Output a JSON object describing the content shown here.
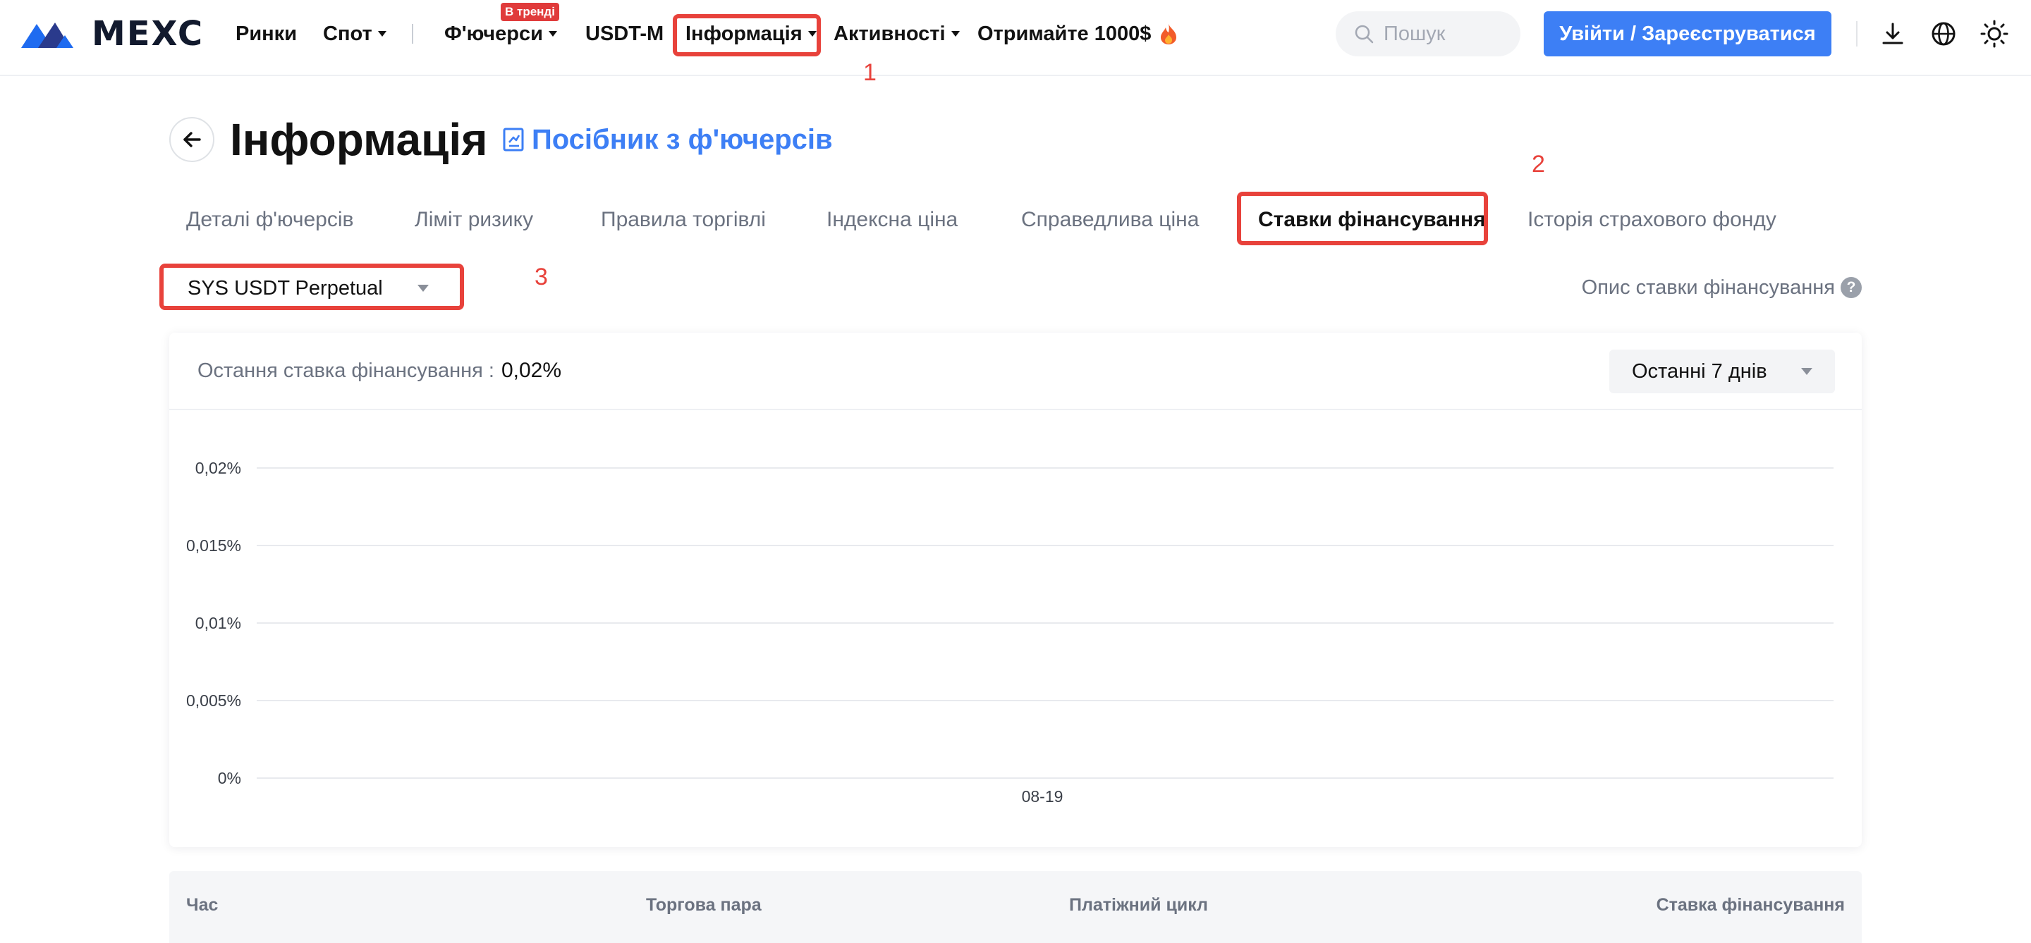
{
  "nav": {
    "logo_text": "MEXC",
    "items": {
      "markets": "Ринки",
      "spot": "Спот",
      "futures": "Ф'ючерси",
      "futures_badge": "В тренді",
      "usdt_m": "USDT-M",
      "info": "Інформація",
      "activities": "Активності",
      "promo": "Отримайте 1000$"
    },
    "search_placeholder": "Пошук",
    "login_button": "Увійти / Зареєструватися"
  },
  "annotations": [
    "1",
    "2",
    "3"
  ],
  "page": {
    "title": "Інформація",
    "guide_link": "Посібник з ф'ючерсів"
  },
  "tabs": [
    {
      "label": "Деталі ф'ючерсів",
      "active": false
    },
    {
      "label": "Ліміт ризику",
      "active": false
    },
    {
      "label": "Правила торгівлі",
      "active": false
    },
    {
      "label": "Індексна ціна",
      "active": false
    },
    {
      "label": "Справедлива ціна",
      "active": false
    },
    {
      "label": "Ставки фінансування",
      "active": true
    },
    {
      "label": "Історія страхового фонду",
      "active": false
    }
  ],
  "contract_select": {
    "value": "SYS USDT Perpetual"
  },
  "funding_description_link": "Опис ставки фінансування",
  "card": {
    "last_rate_label": "Остання ставка фінансування :",
    "last_rate_value": "0,02%",
    "range_value": "Останні 7 днів"
  },
  "chart_data": {
    "type": "line",
    "title": "",
    "xlabel": "",
    "ylabel": "",
    "x": [
      "08-19"
    ],
    "series": [],
    "y_ticks": [
      "0%",
      "0,005%",
      "0,01%",
      "0,015%",
      "0,02%"
    ],
    "ylim": [
      0,
      0.02
    ],
    "grid": true
  },
  "table": {
    "headers": [
      "Час",
      "Торгова пара",
      "Платіжний цикл",
      "Ставка фінансування"
    ]
  },
  "colors": {
    "accent": "#3d7ff5",
    "highlight": "#e8423b",
    "badge": "#e03b3b"
  }
}
